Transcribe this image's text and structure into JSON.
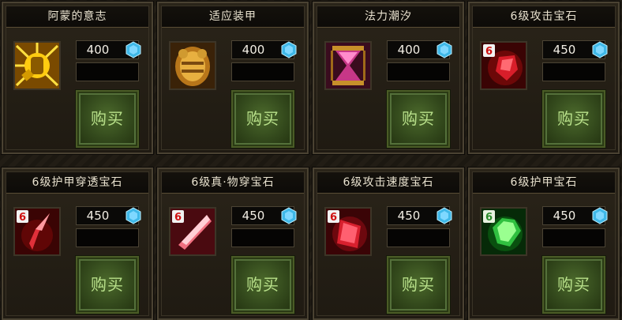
{
  "shop": {
    "items": [
      {
        "name": "阿蒙的意志",
        "price": "400",
        "buy_label": "购买",
        "icon": "amon-will-fist-icon"
      },
      {
        "name": "适应装甲",
        "price": "400",
        "buy_label": "购买",
        "icon": "golden-armor-icon"
      },
      {
        "name": "法力潮汐",
        "price": "400",
        "buy_label": "购买",
        "icon": "hourglass-icon"
      },
      {
        "name": "6级攻击宝石",
        "price": "450",
        "buy_label": "购买",
        "icon": "red-gem-icon",
        "level_badge": "6"
      },
      {
        "name": "6级护甲穿透宝石",
        "price": "450",
        "buy_label": "购买",
        "icon": "red-shard-icon",
        "level_badge": "6"
      },
      {
        "name": "6级真·物穿宝石",
        "price": "450",
        "buy_label": "购买",
        "icon": "red-crystal-icon",
        "level_badge": "6"
      },
      {
        "name": "6级攻击速度宝石",
        "price": "450",
        "buy_label": "购买",
        "icon": "red-cut-gem-icon",
        "level_badge": "6"
      },
      {
        "name": "6级护甲宝石",
        "price": "450",
        "buy_label": "购买",
        "icon": "green-gem-icon",
        "level_badge": "6"
      }
    ],
    "currency_icon": "blue-diamond-icon",
    "colors": {
      "buy_text": "#b8e08a",
      "title_text": "#e9e2cf",
      "currency": "#3fb8e8"
    }
  }
}
